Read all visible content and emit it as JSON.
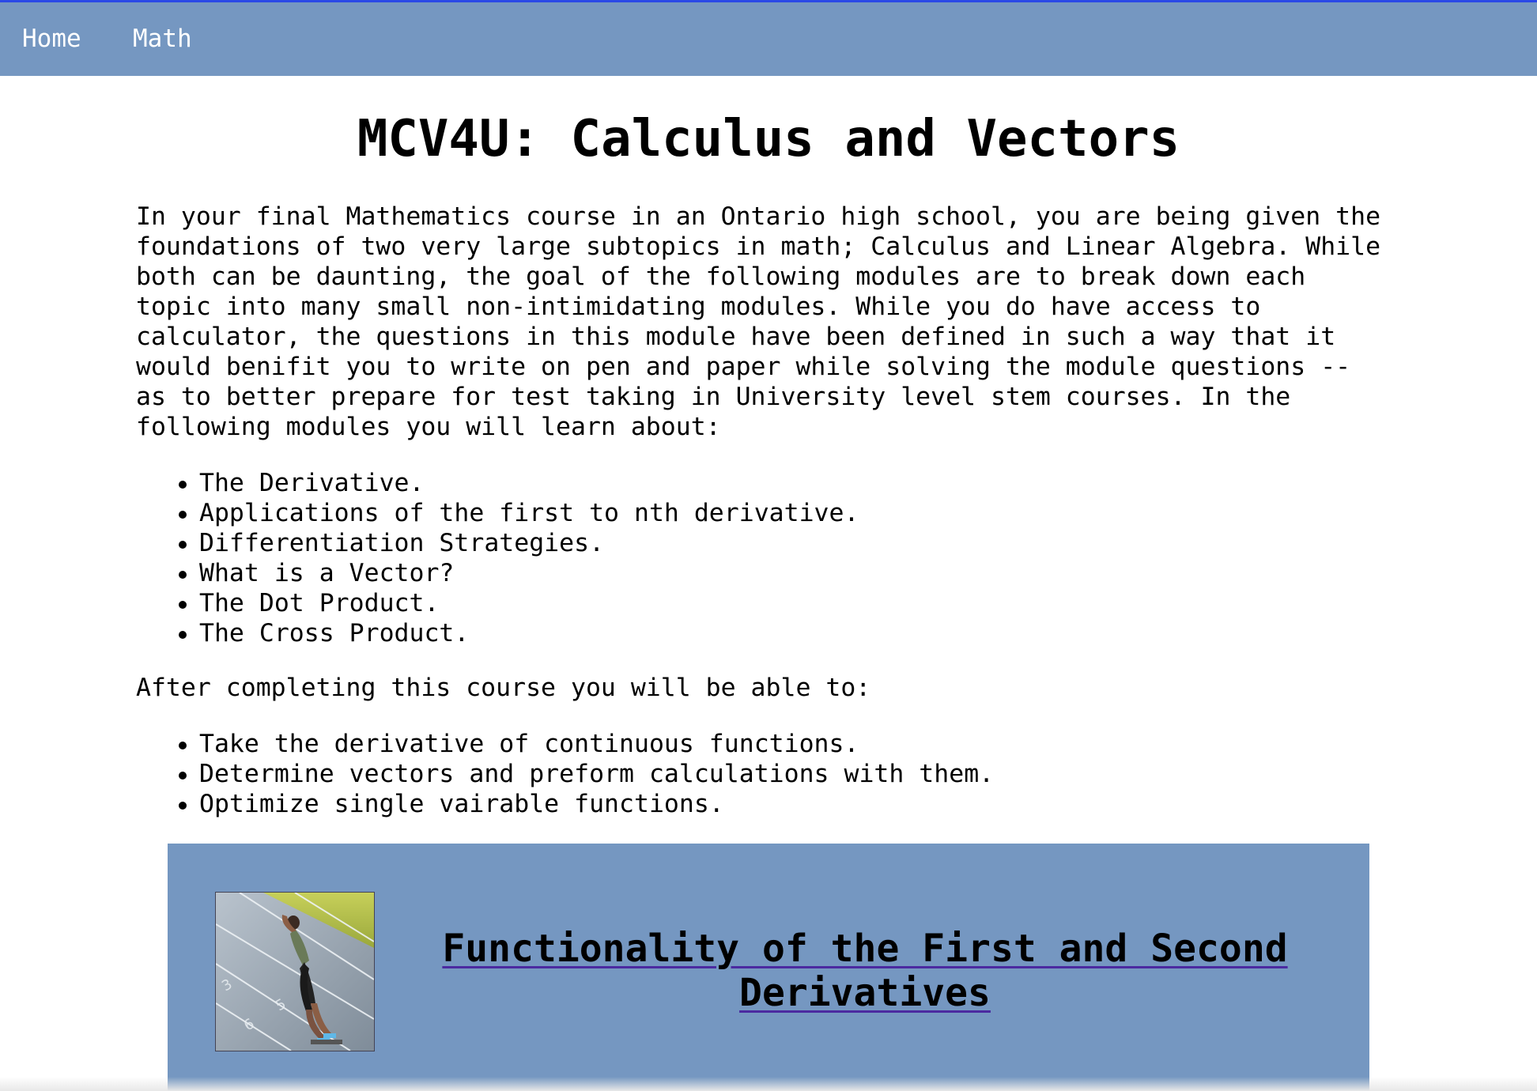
{
  "nav": {
    "items": [
      {
        "label": "Home"
      },
      {
        "label": "Math"
      }
    ]
  },
  "page": {
    "title": "MCV4U: Calculus and Vectors",
    "intro": "In your final Mathematics course in an Ontario high school, you are being given the\nfoundations of two very large subtopics in math; Calculus and Linear Algebra. While\nboth can be daunting, the goal of the following modules are to break down each\ntopic into many small non-intimidating modules. While you do have access to\ncalculator, the questions in this module have been defined in such a way that it\nwould benifit you to write on pen and paper while solving the module questions --\nas to better prepare for test taking in University level stem courses. In the\nfollowing modules you will learn about:",
    "modules": [
      "The Derivative.",
      "Applications of the first to nth derivative.",
      "Differentiation Strategies.",
      "What is a Vector?",
      "The Dot Product.",
      "The Cross Product."
    ],
    "after_text": "After completing this course you will be able to:",
    "outcomes": [
      "Take the derivative of continuous functions.",
      "Determine vectors and preform calculations with them.",
      "Optimize single vairable functions."
    ]
  },
  "module_card": {
    "link_text": "Functionality of the First and Second Derivatives",
    "image_icon": "sprinter-photo"
  },
  "colors": {
    "nav_bg": "#7597c1",
    "top_line": "#2a49e6",
    "card_bg": "#7597c1",
    "link_underline": "#4b2aa0"
  }
}
